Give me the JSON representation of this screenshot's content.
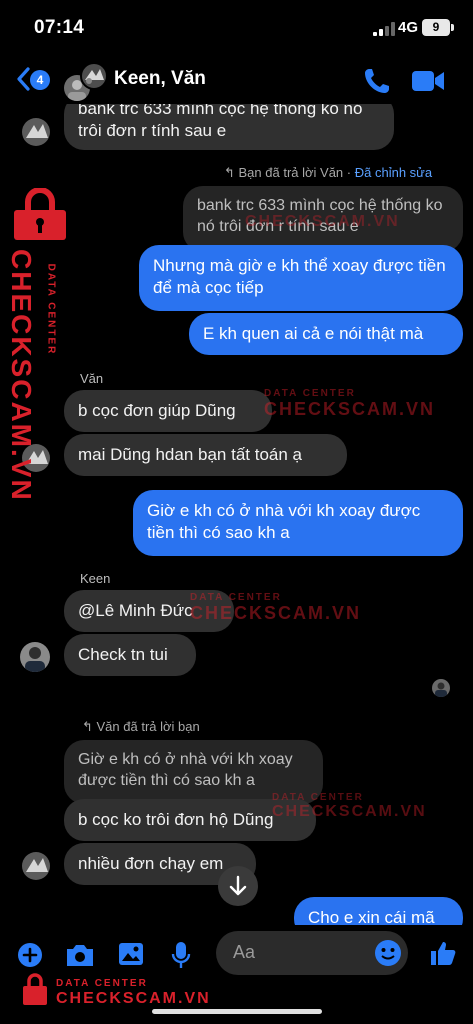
{
  "status_bar": {
    "time": "07:14",
    "network": "4G",
    "battery": "9"
  },
  "header": {
    "unread_count": "4",
    "title": "Keen, Văn"
  },
  "messages": {
    "m0": "bank trc 633 mình cọc hệ thống ko nó trôi đơn r tính sau e",
    "reply1_meta": "Bạn đã trả lời Văn",
    "reply1_edited": "Đã chỉnh sửa",
    "quote1": "bank trc 633 mình cọc hệ thống ko nó trôi đơn r tính sau e",
    "m1": "Nhưng mà giờ e kh thể xoay được tiền để mà cọc tiếp",
    "m2": "E kh quen ai cả e nói thật mà",
    "sender_van": "Văn",
    "m3": "b cọc đơn giúp Dũng",
    "m4": "mai Dũng hdan bạn tất toán ạ",
    "m5": "Giờ e kh có ở nhà với kh xoay được tiền thì có sao kh a",
    "sender_keen": "Keen",
    "m6": "@Lê Minh Đức",
    "m7": "Check tn tui",
    "reply2_meta": "Văn đã trả lời bạn",
    "quote2": "Giờ e kh có ở nhà với kh xoay được tiền thì có sao kh a",
    "m8": "b cọc ko trôi đơn hộ Dũng",
    "m9": "nhiều đơn chạy em",
    "m10": "Cho e xin cái mã"
  },
  "composer": {
    "placeholder": "Aa"
  },
  "watermark": {
    "label": "DATA CENTER",
    "brand": "CHECKSCAM.VN"
  },
  "colors": {
    "accent": "#2a73f0",
    "incoming": "#303030",
    "watermark": "#d9212b"
  }
}
